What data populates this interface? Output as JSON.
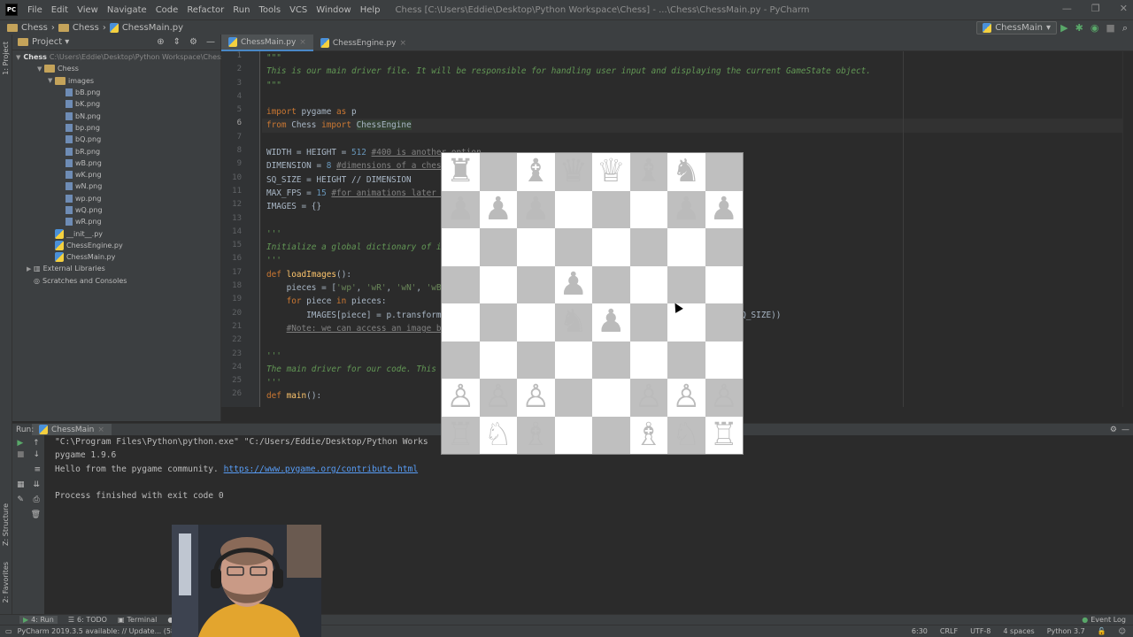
{
  "titlebar": {
    "menus": [
      "File",
      "Edit",
      "View",
      "Navigate",
      "Code",
      "Refactor",
      "Run",
      "Tools",
      "VCS",
      "Window",
      "Help"
    ],
    "title": "Chess [C:\\Users\\Eddie\\Desktop\\Python Workspace\\Chess] - ...\\Chess\\ChessMain.py - PyCharm",
    "logo": "PC"
  },
  "navbar": {
    "crumbs": [
      "Chess",
      "Chess",
      "ChessMain.py"
    ],
    "run_config": "ChessMain"
  },
  "stripe": {
    "project_label": "1: Project",
    "structure_label": "Z: Structure",
    "favorites_label": "2: Favorites"
  },
  "project": {
    "title": "Project",
    "root": "Chess",
    "root_path": "C:\\Users\\Eddie\\Desktop\\Python Workspace\\Chess",
    "tree": [
      {
        "label": "Chess",
        "indent": 2,
        "kind": "folder",
        "arrow": "▼"
      },
      {
        "label": "images",
        "indent": 3,
        "kind": "folder",
        "arrow": "▼"
      },
      {
        "label": "bB.png",
        "indent": 4,
        "kind": "png"
      },
      {
        "label": "bK.png",
        "indent": 4,
        "kind": "png"
      },
      {
        "label": "bN.png",
        "indent": 4,
        "kind": "png"
      },
      {
        "label": "bp.png",
        "indent": 4,
        "kind": "png"
      },
      {
        "label": "bQ.png",
        "indent": 4,
        "kind": "png"
      },
      {
        "label": "bR.png",
        "indent": 4,
        "kind": "png"
      },
      {
        "label": "wB.png",
        "indent": 4,
        "kind": "png"
      },
      {
        "label": "wK.png",
        "indent": 4,
        "kind": "png"
      },
      {
        "label": "wN.png",
        "indent": 4,
        "kind": "png"
      },
      {
        "label": "wp.png",
        "indent": 4,
        "kind": "png"
      },
      {
        "label": "wQ.png",
        "indent": 4,
        "kind": "png"
      },
      {
        "label": "wR.png",
        "indent": 4,
        "kind": "png"
      },
      {
        "label": "__init__.py",
        "indent": 3,
        "kind": "py"
      },
      {
        "label": "ChessEngine.py",
        "indent": 3,
        "kind": "py"
      },
      {
        "label": "ChessMain.py",
        "indent": 3,
        "kind": "py"
      },
      {
        "label": "External Libraries",
        "indent": 1,
        "kind": "lib",
        "arrow": "▶"
      },
      {
        "label": "Scratches and Consoles",
        "indent": 1,
        "kind": "scratch"
      }
    ]
  },
  "editor": {
    "tabs": [
      "ChessMain.py",
      "ChessEngine.py"
    ],
    "line_numbers": [
      "1",
      "2",
      "3",
      "4",
      "5",
      "6",
      "7",
      "8",
      "9",
      "10",
      "11",
      "12",
      "13",
      "14",
      "15",
      "16",
      "17",
      "18",
      "19",
      "20",
      "21",
      "22",
      "23",
      "24",
      "25",
      "26"
    ]
  },
  "run": {
    "label": "Run:",
    "tab": "ChessMain",
    "lines": [
      "\"C:\\Program Files\\Python\\python.exe\" \"C:/Users/Eddie/Desktop/Python Works",
      "pygame 1.9.6",
      "Hello from the pygame community. ",
      "",
      "Process finished with exit code 0"
    ],
    "link": "https://www.pygame.org/contribute.html"
  },
  "bottombar": {
    "tools": [
      "4: Run",
      "6: TODO",
      "Terminal",
      "P"
    ],
    "event_log": "Event Log"
  },
  "statusbar": {
    "message": "PyCharm 2019.3.5 available: // Update... (58 minut",
    "position": "6:30",
    "line_sep": "CRLF",
    "encoding": "UTF-8",
    "indent": "4 spaces",
    "interpreter": "Python 3.7"
  },
  "board": {
    "rows": [
      [
        "♜",
        "",
        "♝",
        "♛",
        "♕",
        "♝",
        "♞",
        ""
      ],
      [
        "♟",
        "♟",
        "♟",
        "",
        "",
        "",
        "♟",
        "♟"
      ],
      [
        "",
        "",
        "",
        "",
        "",
        "",
        "",
        ""
      ],
      [
        "",
        "",
        "",
        "♟",
        "",
        "",
        "",
        ""
      ],
      [
        "",
        "",
        "",
        "♞",
        "♟",
        "",
        "",
        ""
      ],
      [
        "",
        "",
        "",
        "",
        "",
        "",
        "",
        ""
      ],
      [
        "♙",
        "♙",
        "♙",
        "",
        "",
        "♙",
        "♙",
        "♙"
      ],
      [
        "♖",
        "♘",
        "♗",
        "",
        "",
        "♗",
        "♘",
        "♖"
      ]
    ],
    "light": "#ffffff",
    "dark": "#bfbfbf"
  }
}
